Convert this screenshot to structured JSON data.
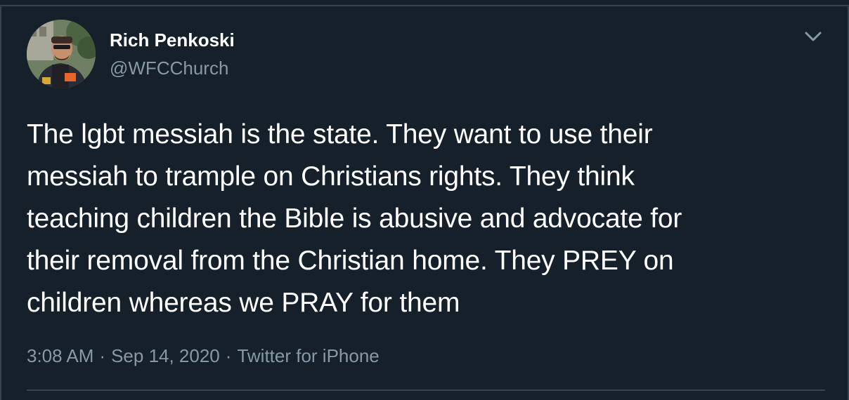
{
  "tweet": {
    "display_name": "Rich Penkoski",
    "handle": "@WFCChurch",
    "text": "The lgbt messiah is the state. They want to use their\nmessiah to trample on Christians rights. They think\nteaching children the Bible is abusive and advocate for\ntheir removal from the Christian home. They PREY on\nchildren whereas we PRAY for them",
    "time": "3:08 AM",
    "separator": "·",
    "date": "Sep 14, 2020",
    "source": "Twitter for iPhone",
    "avatar_icon": "profile-photo",
    "menu_icon": "chevron-down-icon"
  },
  "colors": {
    "background": "#15202b",
    "primary_text": "#ffffff",
    "secondary_text": "#8899a6",
    "border": "#38444d"
  }
}
